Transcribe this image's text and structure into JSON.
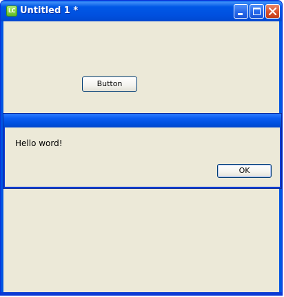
{
  "window": {
    "title": "Untitled 1 *",
    "app_icon_text": "LC",
    "controls": {
      "minimize_icon": "minimize-icon",
      "maximize_icon": "maximize-icon",
      "close_icon": "close-icon"
    }
  },
  "form": {
    "button_label": "Button"
  },
  "dialog": {
    "message": "Hello word!",
    "ok_label": "OK"
  },
  "colors": {
    "titlebar_blue": "#0054e3",
    "client_background": "#ece9d8",
    "close_red": "#d8502a",
    "app_icon_green": "#5ab81d"
  }
}
